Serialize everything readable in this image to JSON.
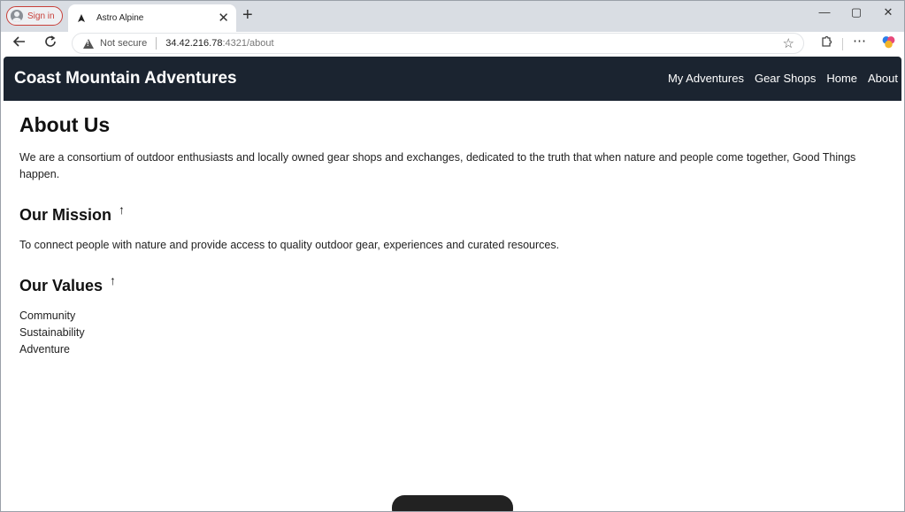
{
  "browser": {
    "profile_label": "Sign in",
    "tab_title": "Astro Alpine",
    "tab_close": "✕",
    "new_tab": "+",
    "window_controls": {
      "minimize": "—",
      "maximize": "▢",
      "close": "✕"
    },
    "not_secure": "Not secure",
    "url_host": "34.42.216.78",
    "url_rest": ":4321/about",
    "icons": {
      "back": "arrow-left-icon",
      "reload": "reload-icon",
      "star": "star-icon",
      "extensions": "puzzle-icon",
      "more": "more-icon",
      "copilot": "copilot-icon"
    }
  },
  "header": {
    "title": "Coast Mountain Adventures",
    "nav": [
      "My Adventures",
      "Gear Shops",
      "Home",
      "About"
    ]
  },
  "main": {
    "title": "About Us",
    "intro": "We are a consortium of outdoor enthusiasts and locally owned gear shops and exchanges, dedicated to the truth that when nature and people come together, Good Things happen.",
    "mission_heading": "Our Mission",
    "mission_text": "To connect people with nature and provide access to quality outdoor gear, experiences and curated resources.",
    "values_heading": "Our Values",
    "values": [
      "Community",
      "Sustainability",
      "Adventure"
    ],
    "anchor_symbol": "↑"
  },
  "colors": {
    "header_bg": "#1b2430",
    "profile_accent": "#c8403a"
  }
}
